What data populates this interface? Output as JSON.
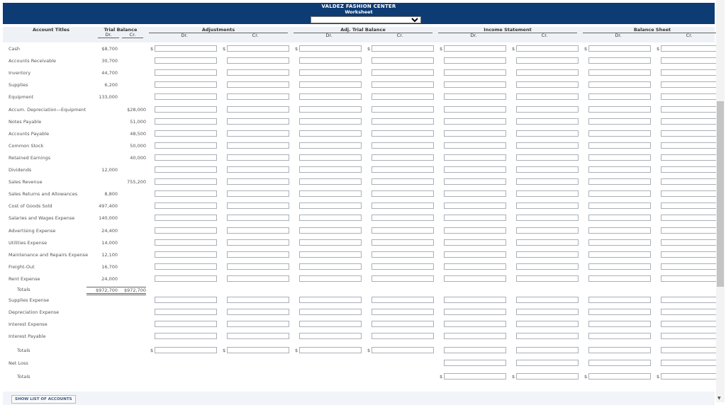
{
  "header": {
    "company": "VALDEZ FASHION CENTER",
    "subtitle": "Worksheet",
    "dropdown_value": ""
  },
  "columns": {
    "account_titles": "Account Titles",
    "trial_balance": "Trial Balance",
    "adjustments": "Adjustments",
    "adj_trial_balance": "Adj. Trial Balance",
    "income_statement": "Income Statement",
    "balance_sheet": "Balance Sheet",
    "dr": "Dr.",
    "cr": "Cr."
  },
  "rows": [
    {
      "name": "Cash",
      "dr": "$8,700",
      "cr": ""
    },
    {
      "name": "Accounts Receivable",
      "dr": "30,700",
      "cr": ""
    },
    {
      "name": "Inventory",
      "dr": "44,700",
      "cr": ""
    },
    {
      "name": "Supplies",
      "dr": "6,200",
      "cr": ""
    },
    {
      "name": "Equipment",
      "dr": "133,000",
      "cr": ""
    },
    {
      "name": "Accum. Depreciation—Equipment",
      "dr": "",
      "cr": "$28,000"
    },
    {
      "name": "Notes Payable",
      "dr": "",
      "cr": "51,000"
    },
    {
      "name": "Accounts Payable",
      "dr": "",
      "cr": "48,500"
    },
    {
      "name": "Common Stock",
      "dr": "",
      "cr": "50,000"
    },
    {
      "name": "Retained Earnings",
      "dr": "",
      "cr": "40,000"
    },
    {
      "name": "Dividends",
      "dr": "12,000",
      "cr": ""
    },
    {
      "name": "Sales Revenue",
      "dr": "",
      "cr": "755,200"
    },
    {
      "name": "Sales Returns and Allowances",
      "dr": "8,800",
      "cr": ""
    },
    {
      "name": "Cost of Goods Sold",
      "dr": "497,400",
      "cr": ""
    },
    {
      "name": "Salaries and Wages Expense",
      "dr": "140,000",
      "cr": ""
    },
    {
      "name": "Advertising Expense",
      "dr": "24,400",
      "cr": ""
    },
    {
      "name": "Utilities Expense",
      "dr": "14,000",
      "cr": ""
    },
    {
      "name": "Maintenance and Repairs Expense",
      "dr": "12,100",
      "cr": ""
    },
    {
      "name": "Freight-Out",
      "dr": "16,700",
      "cr": ""
    },
    {
      "name": "Rent Expense",
      "dr": "24,000",
      "cr": ""
    }
  ],
  "totals_row": {
    "name": "Totals",
    "dr": "$972,700",
    "cr": "$972,700"
  },
  "adj_rows": [
    "Supplies Expense",
    "Depreciation Expense",
    "Interest Expense",
    "Interest Payable"
  ],
  "totals2_label": "Totals",
  "net_loss_label": "Net Loss",
  "totals3_label": "Totals",
  "dollar_sign": "$",
  "show_accounts_button": "SHOW LIST OF ACCOUNTS",
  "colors": {
    "banner": "#0d3b73"
  }
}
